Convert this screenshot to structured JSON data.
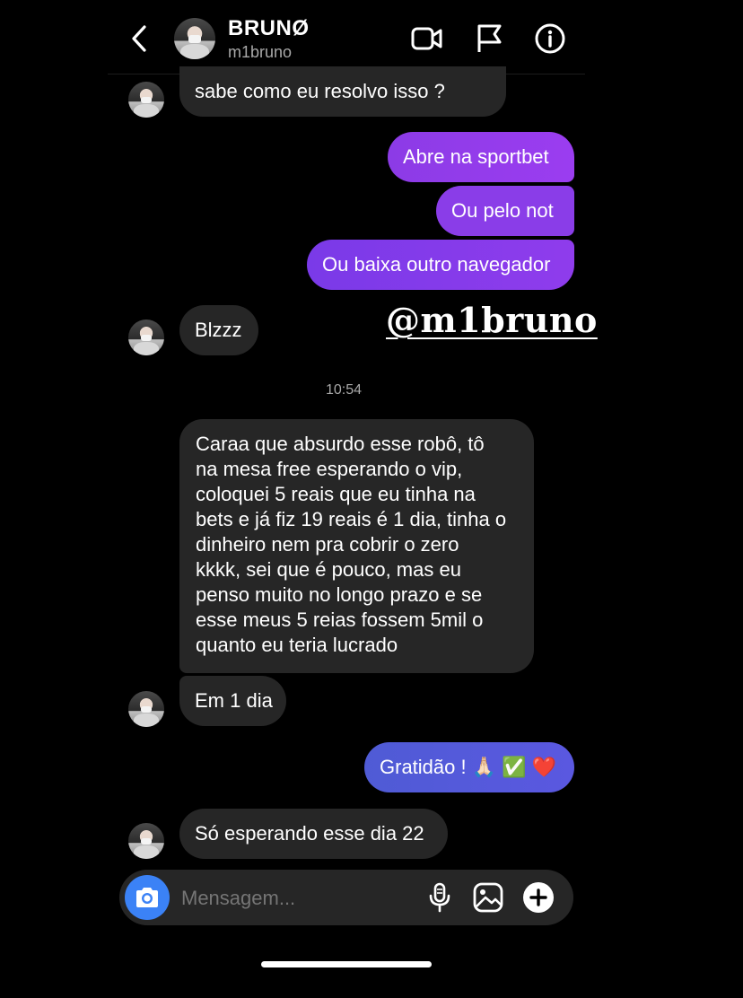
{
  "header": {
    "name": "BRUNØ",
    "username": "m1bruno"
  },
  "messages": [
    {
      "side": "in",
      "text": "sabe como eu resolvo isso ?"
    },
    {
      "side": "out",
      "text": "Abre na sportbet"
    },
    {
      "side": "out",
      "text": "Ou pelo not"
    },
    {
      "side": "out",
      "text": "Ou baixa outro navegador"
    },
    {
      "side": "in",
      "text": "Blzzz"
    },
    {
      "side": "in",
      "lines": [
        "Caraa que absurdo esse robô, tô",
        "na mesa free esperando o vip,",
        "coloquei 5 reais que eu tinha na",
        "bets e já fiz 19 reais é 1 dia, tinha o",
        "dinheiro nem pra cobrir o zero",
        "kkkk, sei que é pouco, mas eu",
        "penso muito no longo prazo e se",
        "esse meus 5 reias fossem 5mil o",
        "quanto eu teria lucrado"
      ]
    },
    {
      "side": "in",
      "text": "Em 1 dia"
    },
    {
      "side": "out",
      "text": "Gratidão ! 🙏🏻 ✅ ❤️"
    },
    {
      "side": "in",
      "text": "Só esperando esse dia 22"
    }
  ],
  "timestamp": "10:54",
  "watermark": "@m1bruno",
  "composer": {
    "placeholder": "Mensagem..."
  },
  "colors": {
    "background": "#000000",
    "incoming_bubble": "#262626",
    "outgoing_gradient": [
      "#4f5bd5",
      "#7c3aed",
      "#9b3df0"
    ],
    "camera_button": "#3b82f6",
    "muted_text": "#a8a8a8"
  },
  "icons": [
    "back-chevron-icon",
    "video-camera-icon",
    "flag-icon",
    "info-icon",
    "camera-icon",
    "microphone-icon",
    "gallery-icon",
    "add-icon"
  ]
}
